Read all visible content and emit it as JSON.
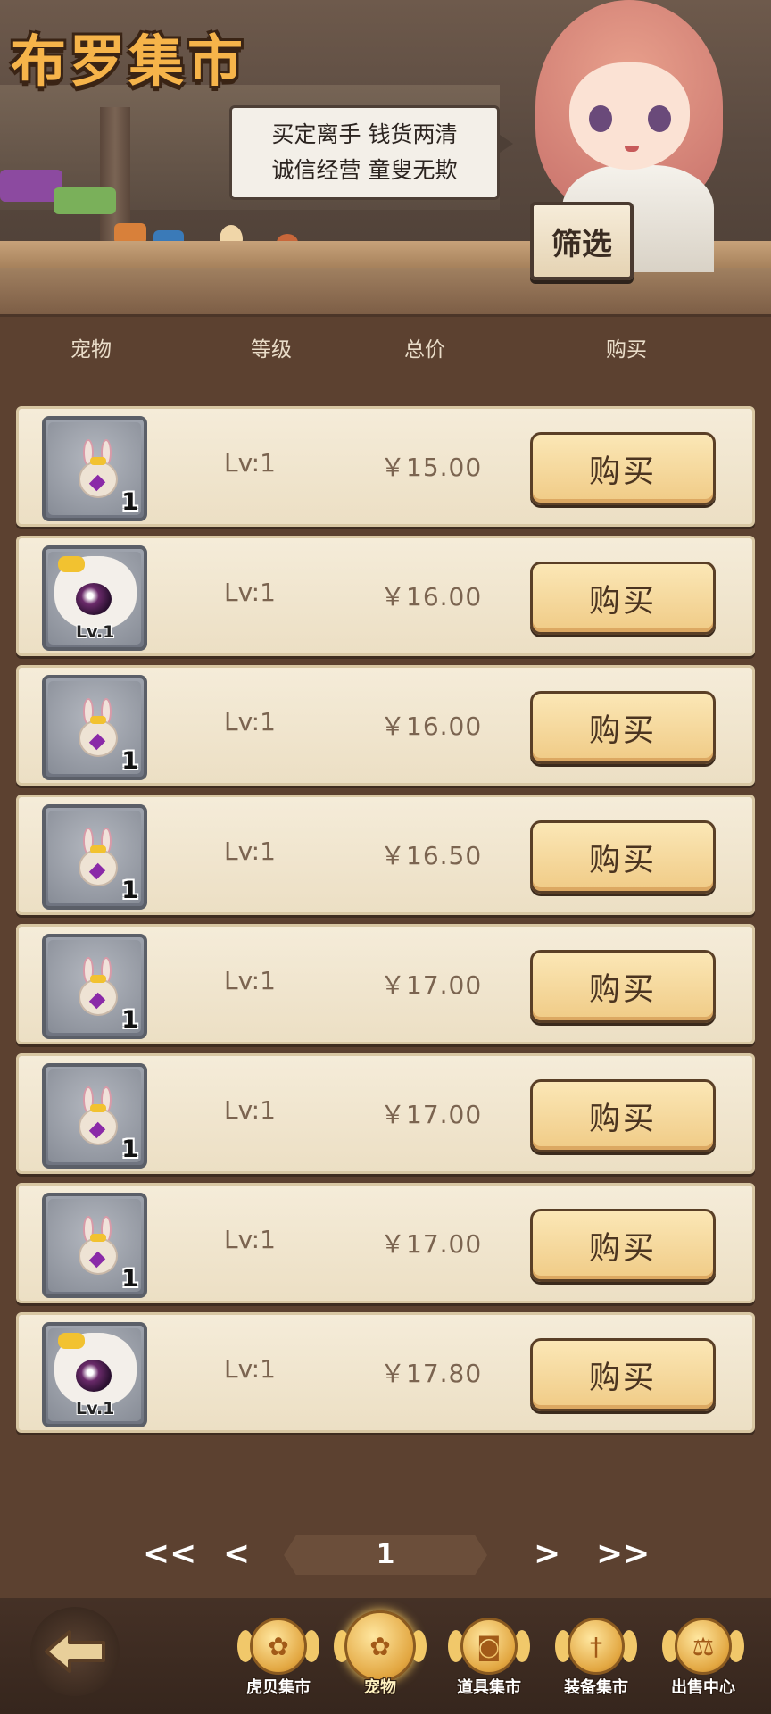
{
  "header": {
    "title": "布罗集市",
    "speech_line1": "买定离手  钱货两清",
    "speech_line2": "诚信经营  童叟无欺",
    "filter_label": "筛选"
  },
  "columns": {
    "pet": "宠物",
    "level": "等级",
    "total_price": "总价",
    "buy": "购买"
  },
  "listings": [
    {
      "pet_icon": "bunny-pet-icon",
      "badge": "1",
      "level": "Lv:1",
      "price": "￥15.00",
      "buy_label": "购买"
    },
    {
      "pet_icon": "cat-pet-icon",
      "badge": "Lv.1",
      "level": "Lv:1",
      "price": "￥16.00",
      "buy_label": "购买"
    },
    {
      "pet_icon": "bunny-pet-icon",
      "badge": "1",
      "level": "Lv:1",
      "price": "￥16.00",
      "buy_label": "购买"
    },
    {
      "pet_icon": "bunny-pet-icon",
      "badge": "1",
      "level": "Lv:1",
      "price": "￥16.50",
      "buy_label": "购买"
    },
    {
      "pet_icon": "bunny-pet-icon",
      "badge": "1",
      "level": "Lv:1",
      "price": "￥17.00",
      "buy_label": "购买"
    },
    {
      "pet_icon": "bunny-pet-icon",
      "badge": "1",
      "level": "Lv:1",
      "price": "￥17.00",
      "buy_label": "购买"
    },
    {
      "pet_icon": "bunny-pet-icon",
      "badge": "1",
      "level": "Lv:1",
      "price": "￥17.00",
      "buy_label": "购买"
    },
    {
      "pet_icon": "cat-pet-icon",
      "badge": "Lv.1",
      "level": "Lv:1",
      "price": "￥17.80",
      "buy_label": "购买"
    }
  ],
  "pagination": {
    "first": "<<",
    "prev": "<",
    "current_page": "1",
    "next": ">",
    "last": ">>"
  },
  "bottom_nav": [
    {
      "label": "虎贝集市",
      "icon": "paw-icon",
      "active": false
    },
    {
      "label": "宠物",
      "icon": "paw-icon",
      "active": true
    },
    {
      "label": "道具集市",
      "icon": "bag-icon",
      "active": false
    },
    {
      "label": "装备集市",
      "icon": "sword-icon",
      "active": false
    },
    {
      "label": "出售中心",
      "icon": "scale-icon",
      "active": false
    }
  ],
  "colors": {
    "title": "#f6b44a",
    "row_bg": "#f5ecd9",
    "buy_button": "#f0cb86",
    "background": "#5c4130"
  }
}
